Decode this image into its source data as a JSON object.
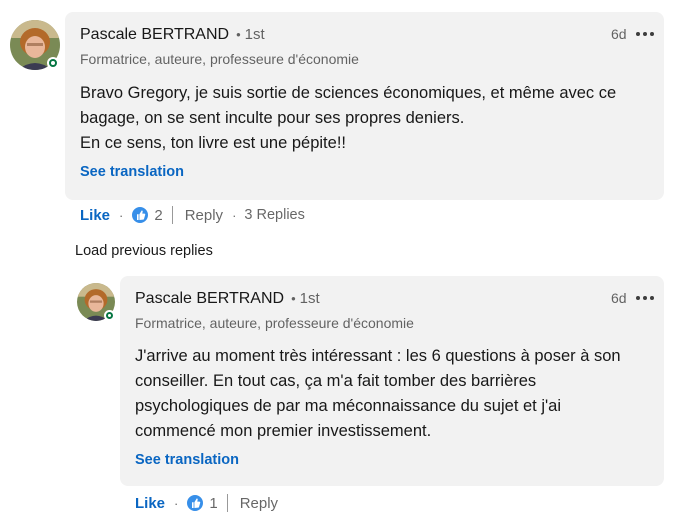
{
  "comment": {
    "author": "Pascale BERTRAND",
    "separator": "•",
    "degree": "1st",
    "headline": "Formatrice, auteure, professeure d'économie",
    "time": "6d",
    "text_lines": [
      "Bravo Gregory, je suis sortie de sciences économiques, et même avec ce",
      "bagage, on se sent inculte pour ses propres deniers.",
      "En ce sens, ton livre est une pépite!!"
    ],
    "see_translation": "See translation",
    "like_label": "Like",
    "reaction_count": "2",
    "reply_label": "Reply",
    "replies_label": "3 Replies",
    "action_separator": "·"
  },
  "load_previous": "Load previous replies",
  "reply": {
    "author": "Pascale BERTRAND",
    "separator": "•",
    "degree": "1st",
    "headline": "Formatrice, auteure, professeure d'économie",
    "time": "6d",
    "text_lines": [
      "J'arrive au moment très intéressant : les 6 questions à poser à son",
      "conseiller. En tout cas, ça m'a fait tomber des barrières",
      "psychologiques de par ma méconnaissance du sujet et j'ai",
      "commencé mon premier investissement."
    ],
    "see_translation": "See translation",
    "like_label": "Like",
    "reaction_count": "1",
    "reply_label": "Reply",
    "action_separator": "·"
  },
  "icons": {
    "avatar": "avatar-photo",
    "presence": "online-presence-icon",
    "more": "more-options-icon",
    "reaction": "like-reaction-icon"
  },
  "colors": {
    "bubble": "#f2f2f2",
    "link": "#0a66c2",
    "presence": "#057642",
    "reaction": "#378fe9"
  }
}
